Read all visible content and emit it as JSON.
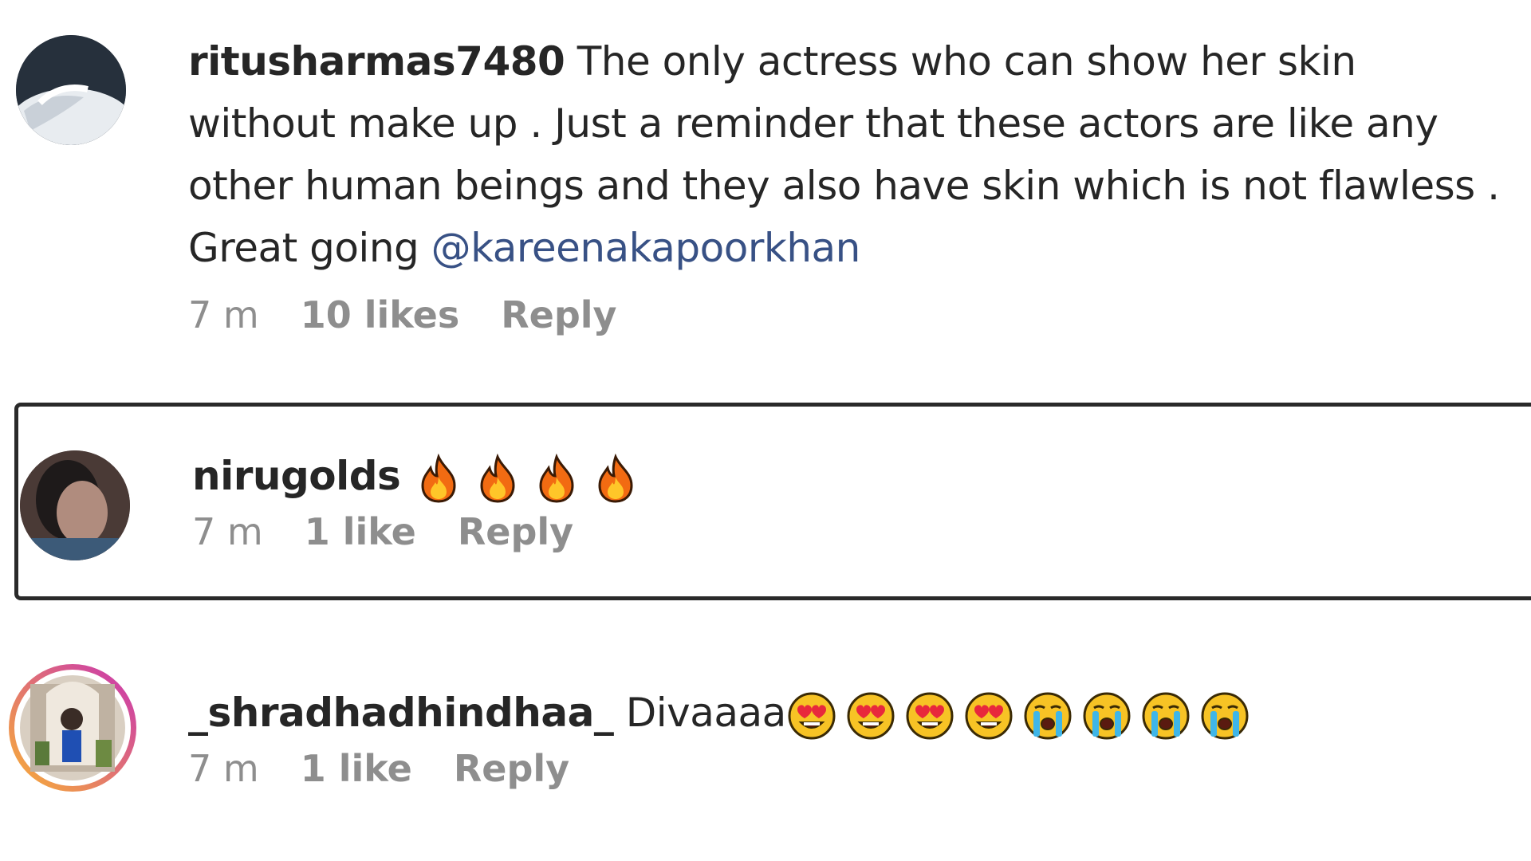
{
  "comments": [
    {
      "username": "ritusharmas7480",
      "text": "The only actress who can show her skin without make up . Just a reminder that these actors are like any other human beings and they also have skin which is not flawless . Great going ",
      "mention": "@kareenakapoorkhan",
      "time": "7 m",
      "likes": "10 likes",
      "reply": "Reply"
    },
    {
      "username": "nirugolds",
      "emojis": [
        "fire-icon",
        "fire-icon",
        "fire-icon",
        "fire-icon"
      ],
      "time": "7 m",
      "likes": "1 like",
      "reply": "Reply"
    },
    {
      "username": "_shradhadhindhaa_",
      "text": "Divaaaa",
      "emojis": [
        "heart-eyes-icon",
        "heart-eyes-icon",
        "heart-eyes-icon",
        "heart-eyes-icon",
        "crying-face-icon",
        "crying-face-icon",
        "crying-face-icon",
        "crying-face-icon"
      ],
      "time": "7 m",
      "likes": "1 like",
      "reply": "Reply"
    }
  ],
  "colors": {
    "username": "#262626",
    "mention": "#385185",
    "meta": "#8e8e8e",
    "highlight_border": "#2a2a2a",
    "story_ring_start": "#f9b233",
    "story_ring_end": "#c832b4"
  }
}
